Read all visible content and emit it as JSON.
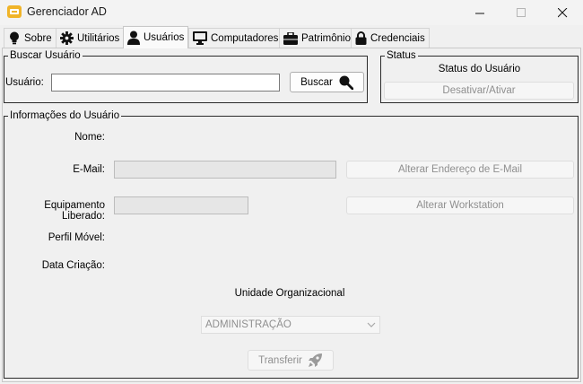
{
  "window": {
    "title": "Gerenciador AD"
  },
  "tabs": [
    {
      "label": "Sobre",
      "icon": "lightbulb-icon"
    },
    {
      "label": "Utilitários",
      "icon": "gear-icon"
    },
    {
      "label": "Usuários",
      "icon": "user-icon",
      "active": true
    },
    {
      "label": "Computadores",
      "icon": "monitor-icon"
    },
    {
      "label": "Patrimônio",
      "icon": "briefcase-icon"
    },
    {
      "label": "Credenciais",
      "icon": "lock-icon"
    }
  ],
  "search": {
    "legend": "Buscar Usuário",
    "user_label": "Usuário:",
    "user_value": "",
    "button_label": "Buscar"
  },
  "status": {
    "legend": "Status",
    "heading": "Status do Usuário",
    "toggle_label": "Desativar/Ativar"
  },
  "info": {
    "legend": "Informações do Usuário",
    "name_label": "Nome:",
    "email_label": "E-Mail:",
    "email_value": "",
    "change_email_label": "Alterar Endereço de E-Mail",
    "equipment_label": "Equipamento Liberado:",
    "equipment_value": "",
    "change_workstation_label": "Alterar Workstation",
    "profile_label": "Perfil Móvel:",
    "created_label": "Data Criação:",
    "ou_heading": "Unidade Organizacional",
    "ou_selected": "ADMINISTRAÇÃO",
    "transfer_label": "Transferir"
  },
  "colors": {
    "window_bg": "#f0f0f0",
    "border_dark": "#2b2b2b",
    "disabled_text": "#8f8f8f",
    "app_icon": "#f0b429"
  }
}
